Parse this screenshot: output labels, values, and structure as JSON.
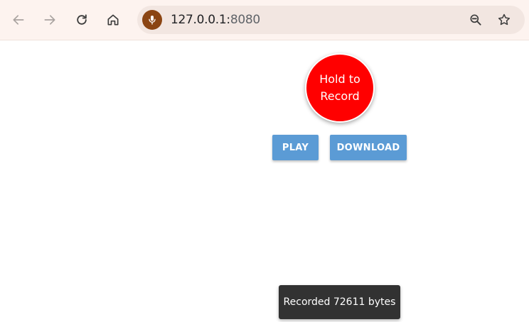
{
  "browser": {
    "url_host": "127.0.0.1:",
    "url_port": "8080",
    "icons": {
      "back": "arrow-left-icon",
      "forward": "arrow-right-icon",
      "reload": "reload-icon",
      "home": "home-icon",
      "site": "microphone-icon",
      "zoom": "zoom-out-icon",
      "bookmark": "star-icon"
    }
  },
  "app": {
    "record_button_label": "Hold to Record",
    "play_label": "PLAY",
    "download_label": "DOWNLOAD",
    "toast_message": "Recorded 72611 bytes"
  },
  "colors": {
    "record": "#ff0000",
    "action_buttons": "#5b9bd5",
    "toast_bg": "#323232",
    "toolbar_bg": "#fdf3ef",
    "omnibox_bg": "#f2e6e1",
    "site_badge": "#8b4513"
  }
}
